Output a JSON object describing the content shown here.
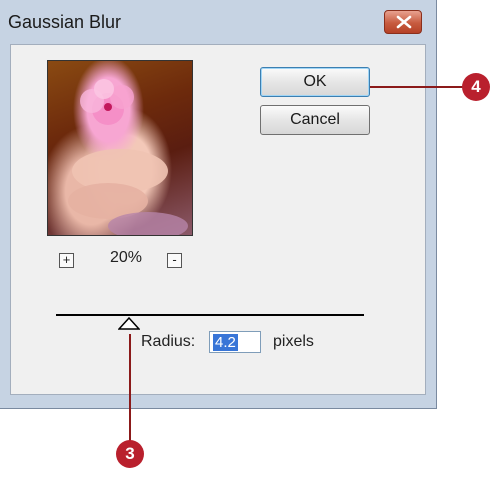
{
  "dialog": {
    "title": "Gaussian Blur",
    "ok_label": "OK",
    "cancel_label": "Cancel",
    "zoom_in_label": "+",
    "zoom_out_label": "-",
    "zoom_value": "20%",
    "radius_label": "Radius:",
    "radius_value": "4.2",
    "units_label": "pixels"
  },
  "callouts": {
    "ok_step": "4",
    "radius_step": "3"
  },
  "colors": {
    "callout": "#b9202d",
    "dialog_frame": "#c6d3e3",
    "close_button": "#c75b3f"
  },
  "icons": {
    "close": "close-icon",
    "slider_thumb": "triangle-up-icon"
  }
}
